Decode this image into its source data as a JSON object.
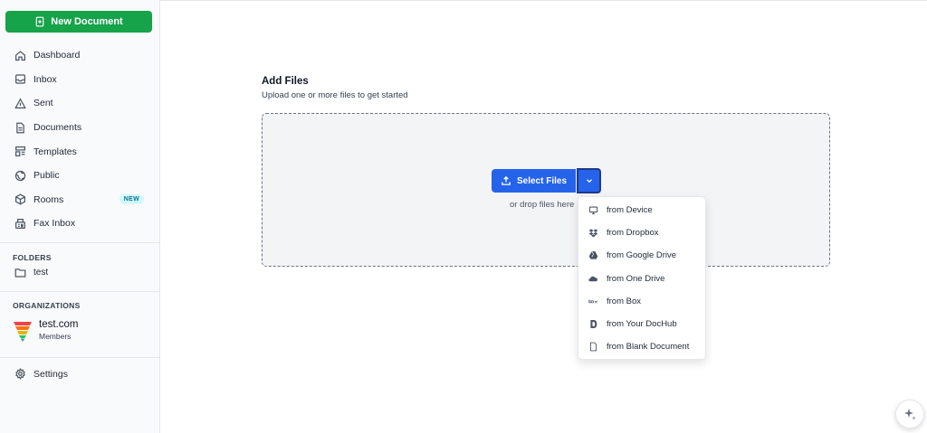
{
  "sidebar": {
    "new_document_label": "New Document",
    "items": [
      {
        "label": "Dashboard",
        "icon": "home-icon"
      },
      {
        "label": "Inbox",
        "icon": "inbox-icon"
      },
      {
        "label": "Sent",
        "icon": "sent-icon"
      },
      {
        "label": "Documents",
        "icon": "document-icon"
      },
      {
        "label": "Templates",
        "icon": "template-icon"
      },
      {
        "label": "Public",
        "icon": "globe-icon"
      },
      {
        "label": "Rooms",
        "icon": "cube-icon",
        "badge": "NEW"
      },
      {
        "label": "Fax Inbox",
        "icon": "fax-icon"
      }
    ],
    "folders_title": "FOLDERS",
    "folders": [
      {
        "label": "test"
      }
    ],
    "organizations_title": "ORGANIZATIONS",
    "organization": {
      "name": "test.com",
      "subtitle": "Members"
    },
    "settings_label": "Settings"
  },
  "main": {
    "title": "Add Files",
    "subtitle": "Upload one or more files to get started",
    "select_files_label": "Select Files",
    "drop_text": "or drop files here",
    "menu": [
      {
        "label": "from Device",
        "icon": "monitor-icon"
      },
      {
        "label": "from Dropbox",
        "icon": "dropbox-icon"
      },
      {
        "label": "from Google Drive",
        "icon": "google-drive-icon"
      },
      {
        "label": "from One Drive",
        "icon": "onedrive-icon"
      },
      {
        "label": "from Box",
        "icon": "box-icon"
      },
      {
        "label": "from Your DocHub",
        "icon": "dochub-icon"
      },
      {
        "label": "from Blank Document",
        "icon": "blank-document-icon"
      }
    ]
  },
  "colors": {
    "primary_green": "#16a34a",
    "primary_blue": "#2563eb",
    "badge_bg": "#cffafe",
    "badge_text": "#0e7490"
  }
}
